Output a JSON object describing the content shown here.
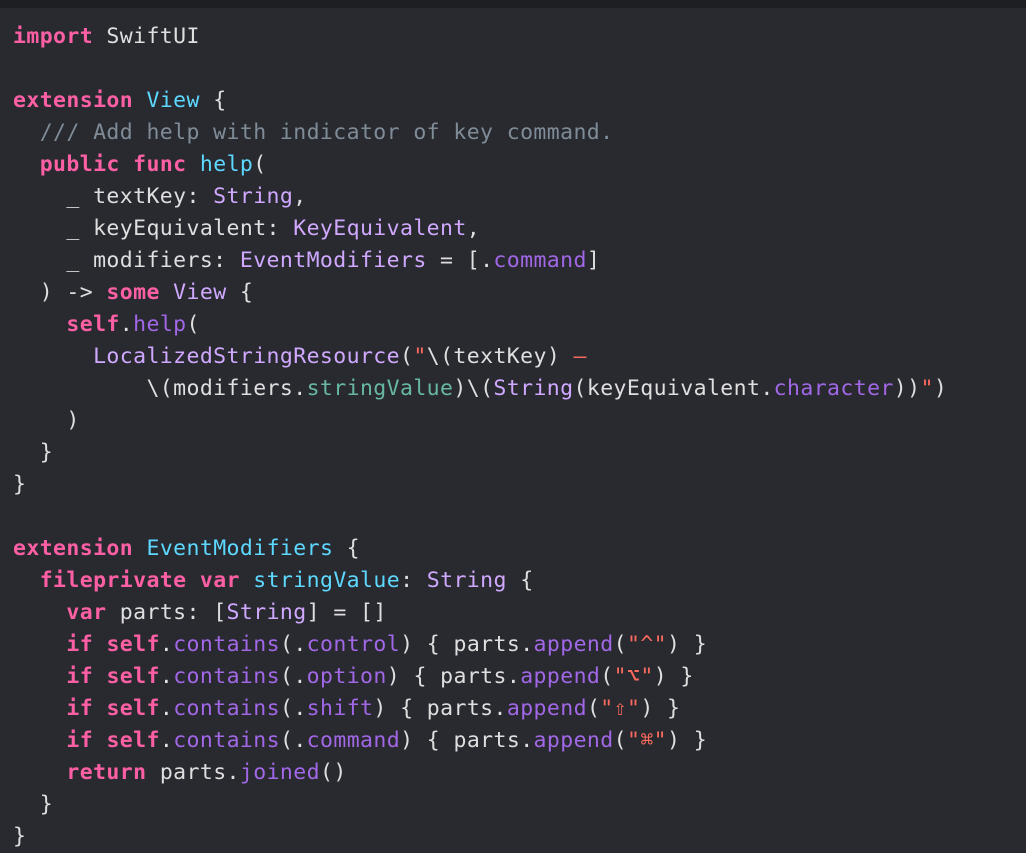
{
  "editor": {
    "background": "#292a30",
    "colors": {
      "keyword": "#fc5fa3",
      "type": "#d0a8ff",
      "type_declaration": "#5dd8ff",
      "function": "#a167e6",
      "property": "#67b7a4",
      "string": "#fc6a5d",
      "comment": "#7f8c98",
      "plain": "#dfdfe0"
    },
    "lines": [
      [
        [
          "kw",
          "import"
        ],
        [
          "pl",
          " SwiftUI"
        ]
      ],
      [],
      [
        [
          "kw",
          "extension"
        ],
        [
          "pl",
          " "
        ],
        [
          "tyd",
          "View"
        ],
        [
          "pl",
          " {"
        ]
      ],
      [
        [
          "pl",
          "  "
        ],
        [
          "cmt",
          "/// Add help with indicator of key command."
        ]
      ],
      [
        [
          "pl",
          "  "
        ],
        [
          "kw",
          "public"
        ],
        [
          "pl",
          " "
        ],
        [
          "kw",
          "func"
        ],
        [
          "pl",
          " "
        ],
        [
          "tyd",
          "help"
        ],
        [
          "pl",
          "("
        ]
      ],
      [
        [
          "pl",
          "    _ textKey: "
        ],
        [
          "typ",
          "String"
        ],
        [
          "pl",
          ","
        ]
      ],
      [
        [
          "pl",
          "    _ keyEquivalent: "
        ],
        [
          "typ",
          "KeyEquivalent"
        ],
        [
          "pl",
          ","
        ]
      ],
      [
        [
          "pl",
          "    _ modifiers: "
        ],
        [
          "typ",
          "EventModifiers"
        ],
        [
          "pl",
          " = [."
        ],
        [
          "fn",
          "command"
        ],
        [
          "pl",
          "]"
        ]
      ],
      [
        [
          "pl",
          "  ) -> "
        ],
        [
          "kw",
          "some"
        ],
        [
          "pl",
          " "
        ],
        [
          "typ",
          "View"
        ],
        [
          "pl",
          " {"
        ]
      ],
      [
        [
          "pl",
          "    "
        ],
        [
          "kw",
          "self"
        ],
        [
          "pl",
          "."
        ],
        [
          "fn",
          "help"
        ],
        [
          "pl",
          "("
        ]
      ],
      [
        [
          "pl",
          "      "
        ],
        [
          "typ",
          "LocalizedStringResource"
        ],
        [
          "pl",
          "("
        ],
        [
          "str",
          "\""
        ],
        [
          "pl",
          "\\(textKey) "
        ],
        [
          "str",
          "—"
        ]
      ],
      [
        [
          "pl",
          "          \\(modifiers."
        ],
        [
          "prop",
          "stringValue"
        ],
        [
          "pl",
          ")\\("
        ],
        [
          "typ",
          "String"
        ],
        [
          "pl",
          "(keyEquivalent."
        ],
        [
          "fn",
          "character"
        ],
        [
          "pl",
          "))"
        ],
        [
          "str",
          "\""
        ],
        [
          "pl",
          ")"
        ]
      ],
      [
        [
          "pl",
          "    )"
        ]
      ],
      [
        [
          "pl",
          "  }"
        ]
      ],
      [
        [
          "pl",
          "}"
        ]
      ],
      [],
      [
        [
          "kw",
          "extension"
        ],
        [
          "pl",
          " "
        ],
        [
          "tyd",
          "EventModifiers"
        ],
        [
          "pl",
          " {"
        ]
      ],
      [
        [
          "pl",
          "  "
        ],
        [
          "kw",
          "fileprivate"
        ],
        [
          "pl",
          " "
        ],
        [
          "kw",
          "var"
        ],
        [
          "pl",
          " "
        ],
        [
          "tyd",
          "stringValue"
        ],
        [
          "pl",
          ": "
        ],
        [
          "typ",
          "String"
        ],
        [
          "pl",
          " {"
        ]
      ],
      [
        [
          "pl",
          "    "
        ],
        [
          "kw",
          "var"
        ],
        [
          "pl",
          " parts: ["
        ],
        [
          "typ",
          "String"
        ],
        [
          "pl",
          "] = []"
        ]
      ],
      [
        [
          "pl",
          "    "
        ],
        [
          "kw",
          "if"
        ],
        [
          "pl",
          " "
        ],
        [
          "kw",
          "self"
        ],
        [
          "pl",
          "."
        ],
        [
          "fn",
          "contains"
        ],
        [
          "pl",
          "(."
        ],
        [
          "fn",
          "control"
        ],
        [
          "pl",
          ") { parts."
        ],
        [
          "fn",
          "append"
        ],
        [
          "pl",
          "("
        ],
        [
          "str",
          "\"^\""
        ],
        [
          "pl",
          ") }"
        ]
      ],
      [
        [
          "pl",
          "    "
        ],
        [
          "kw",
          "if"
        ],
        [
          "pl",
          " "
        ],
        [
          "kw",
          "self"
        ],
        [
          "pl",
          "."
        ],
        [
          "fn",
          "contains"
        ],
        [
          "pl",
          "(."
        ],
        [
          "fn",
          "option"
        ],
        [
          "pl",
          ") { parts."
        ],
        [
          "fn",
          "append"
        ],
        [
          "pl",
          "("
        ],
        [
          "str",
          "\"⌥\""
        ],
        [
          "pl",
          ") }"
        ]
      ],
      [
        [
          "pl",
          "    "
        ],
        [
          "kw",
          "if"
        ],
        [
          "pl",
          " "
        ],
        [
          "kw",
          "self"
        ],
        [
          "pl",
          "."
        ],
        [
          "fn",
          "contains"
        ],
        [
          "pl",
          "(."
        ],
        [
          "fn",
          "shift"
        ],
        [
          "pl",
          ") { parts."
        ],
        [
          "fn",
          "append"
        ],
        [
          "pl",
          "("
        ],
        [
          "str",
          "\"⇧\""
        ],
        [
          "pl",
          ") }"
        ]
      ],
      [
        [
          "pl",
          "    "
        ],
        [
          "kw",
          "if"
        ],
        [
          "pl",
          " "
        ],
        [
          "kw",
          "self"
        ],
        [
          "pl",
          "."
        ],
        [
          "fn",
          "contains"
        ],
        [
          "pl",
          "(."
        ],
        [
          "fn",
          "command"
        ],
        [
          "pl",
          ") { parts."
        ],
        [
          "fn",
          "append"
        ],
        [
          "pl",
          "("
        ],
        [
          "str",
          "\"⌘\""
        ],
        [
          "pl",
          ") }"
        ]
      ],
      [
        [
          "pl",
          "    "
        ],
        [
          "kw",
          "return"
        ],
        [
          "pl",
          " parts."
        ],
        [
          "fn",
          "joined"
        ],
        [
          "pl",
          "()"
        ]
      ],
      [
        [
          "pl",
          "  }"
        ]
      ],
      [
        [
          "pl",
          "}"
        ]
      ]
    ]
  }
}
